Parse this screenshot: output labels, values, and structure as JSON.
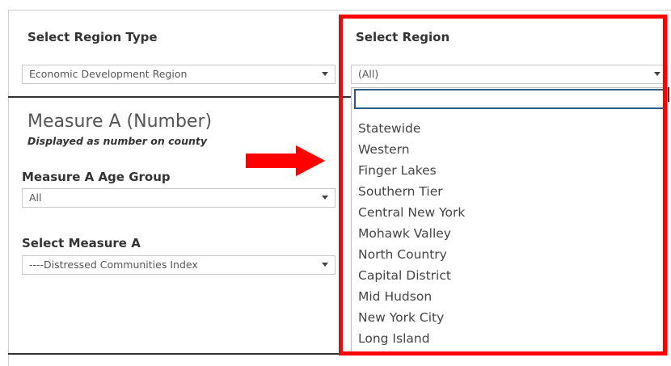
{
  "region_type": {
    "label": "Select Region Type",
    "selected": "Economic Development Region"
  },
  "region": {
    "label": "Select Region",
    "selected": "(All)",
    "search_value": "",
    "options": [
      "Statewide",
      "Western",
      "Finger Lakes",
      "Southern Tier",
      "Central New York",
      "Mohawk Valley",
      "North Country",
      "Capital District",
      "Mid Hudson",
      "New York City",
      "Long Island"
    ]
  },
  "measure_a": {
    "title": "Measure A (Number)",
    "subtitle": "Displayed as number on county",
    "age_group_label": "Measure A Age Group",
    "age_group_selected": "All",
    "select_label": "Select Measure A",
    "select_selected": "----Distressed Communities Index"
  },
  "colors": {
    "highlight": "#ff0000",
    "search_border": "#2a5b80"
  },
  "icons": {
    "arrow": "right-arrow-icon",
    "caret": "chevron-down-icon"
  }
}
